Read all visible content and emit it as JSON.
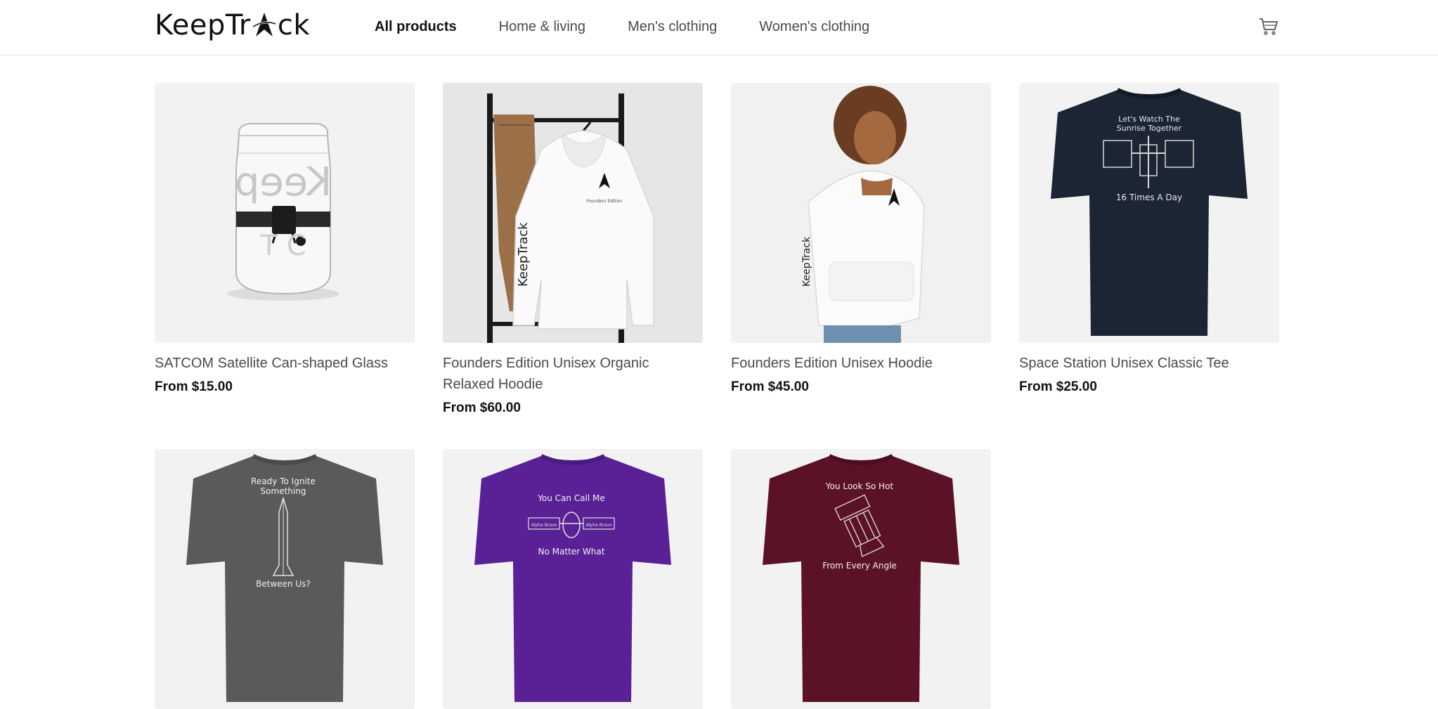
{
  "brand": {
    "logo_prefix": "KeepTr",
    "logo_suffix": "ck"
  },
  "nav": {
    "items": [
      {
        "label": "All products",
        "active": true
      },
      {
        "label": "Home & living",
        "active": false
      },
      {
        "label": "Men's clothing",
        "active": false
      },
      {
        "label": "Women's clothing",
        "active": false
      }
    ]
  },
  "icons": {
    "cart": "cart-icon",
    "logo_mark": "star-swoosh-icon"
  },
  "products": [
    {
      "name": "SATCOM Satellite Can-shaped Glass",
      "price": "From $15.00",
      "image": "glass-can-image"
    },
    {
      "name": "Founders Edition Unisex Organic Relaxed Hoodie",
      "price": "From $60.00",
      "image": "hoodie-on-rack-image"
    },
    {
      "name": "Founders Edition Unisex Hoodie",
      "price": "From $45.00",
      "image": "model-hoodie-image"
    },
    {
      "name": "Space Station Unisex Classic Tee",
      "price": "From $25.00",
      "image": "navy-tee-image",
      "print_top": "Let's Watch The",
      "print_top2": "Sunrise Together",
      "print_bottom": "16 Times A Day"
    },
    {
      "name": "",
      "price": "",
      "image": "gray-tee-image",
      "print_top": "Ready To Ignite",
      "print_top2": "Something",
      "print_bottom": "Between Us?"
    },
    {
      "name": "",
      "price": "",
      "image": "purple-tee-image",
      "print_top": "You Can Call Me",
      "print_bottom": "No Matter What",
      "panel_text": "Alpha Bravo"
    },
    {
      "name": "",
      "price": "",
      "image": "maroon-tee-image",
      "print_top": "You Look So Hot",
      "print_bottom": "From Every Angle"
    }
  ],
  "product_images_text": {
    "glass_print": "Keep",
    "hoodie_sleeve": "KeepTrack",
    "hoodie_chest": "Founders Edition"
  },
  "colors": {
    "navy_tee": "#1c2533",
    "gray_tee": "#5a5a5a",
    "purple_tee": "#5a2196",
    "maroon_tee": "#5c1226",
    "card_bg": "#f2f2f2"
  }
}
